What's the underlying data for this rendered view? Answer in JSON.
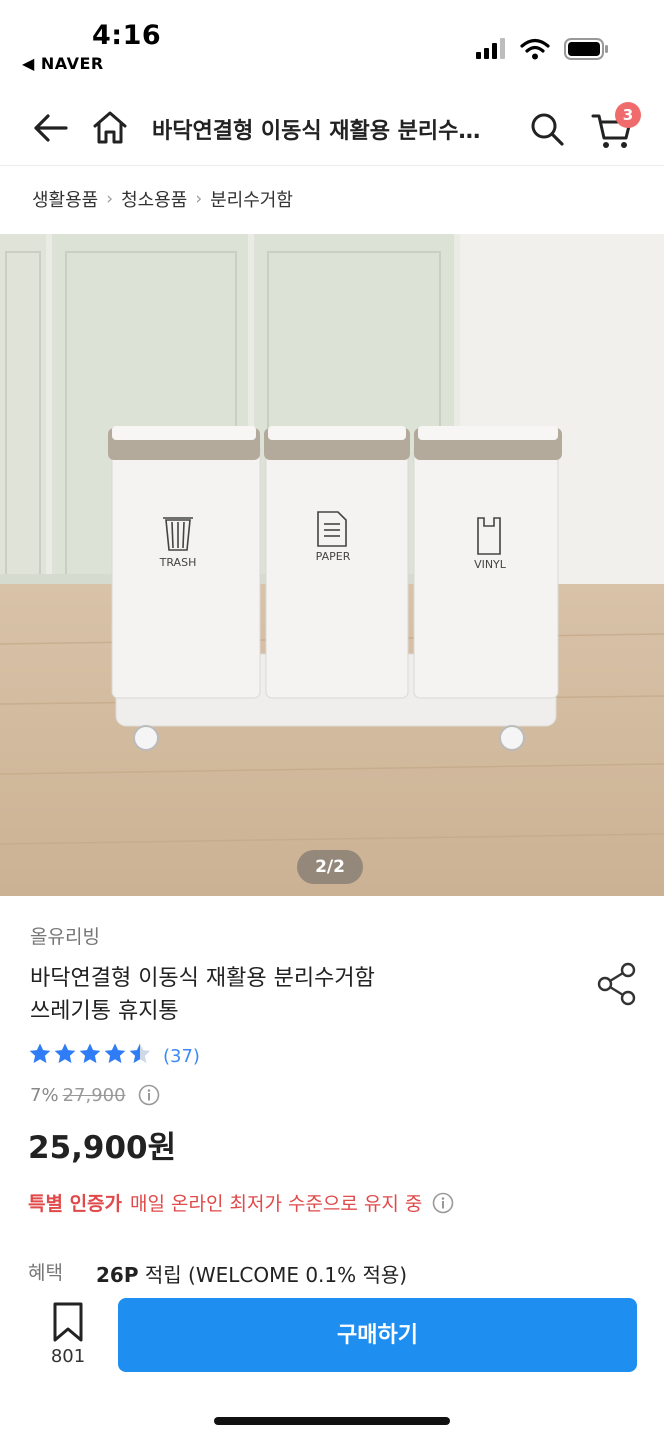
{
  "status_bar": {
    "time": "4:16",
    "back_app": "◀ NAVER"
  },
  "header": {
    "title": "바닥연결형 이동식 재활용 분리수…",
    "cart_count": "3"
  },
  "breadcrumb": [
    "생활용품",
    "청소용품",
    "분리수거함"
  ],
  "image": {
    "counter": "2/2",
    "bins": [
      {
        "label": "TRASH"
      },
      {
        "label": "PAPER"
      },
      {
        "label": "VINYL"
      }
    ]
  },
  "product": {
    "seller": "올유리빙",
    "name_line1": "바닥연결형 이동식 재활용 분리수거함",
    "name_line2": "쓰레기통 휴지통",
    "rating": 4.5,
    "review_count": "(37)",
    "discount": "7%",
    "original_price": "27,900",
    "price": "25,900원",
    "lowest_strong": "특별 인증가",
    "lowest_text": "매일 온라인 최저가 수준으로 유지 중",
    "benefit_label": "혜택",
    "benefit_points": "26P",
    "benefit_text": "적립 (WELCOME 0.1% 적용)"
  },
  "bottom_bar": {
    "bookmark_count": "801",
    "buy_label": "구매하기"
  },
  "colors": {
    "accent": "#1f8ef1",
    "star": "#2f7df6",
    "badge": "#f06b6b",
    "highlight": "#e04a4a"
  }
}
